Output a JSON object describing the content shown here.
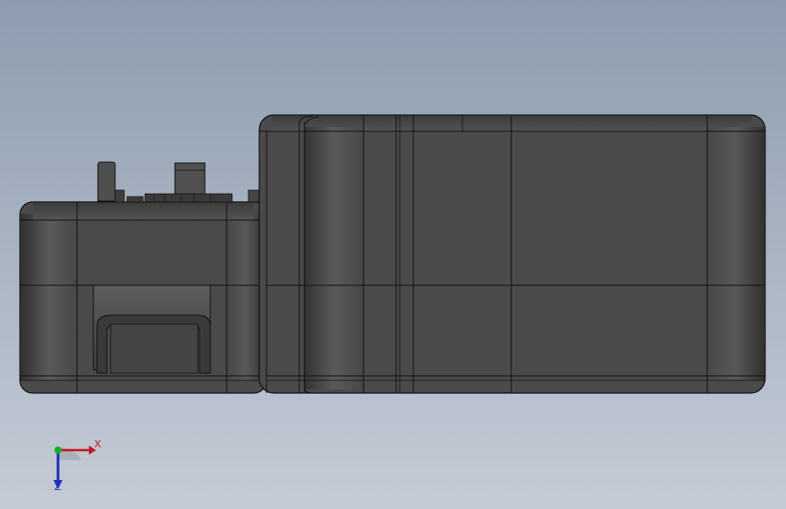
{
  "viewport": {
    "background_top": "#8d9cb0",
    "background_bottom": "#c4cbd6"
  },
  "model": {
    "body_color": "#4a4a4a",
    "edge_color": "#111111",
    "highlight_color": "#6e6e6e"
  },
  "triad": {
    "x_label": "X",
    "z_label": "Z",
    "x_color": "#c8141e",
    "z_color": "#1e2fb8",
    "y_color": "#18b020"
  }
}
